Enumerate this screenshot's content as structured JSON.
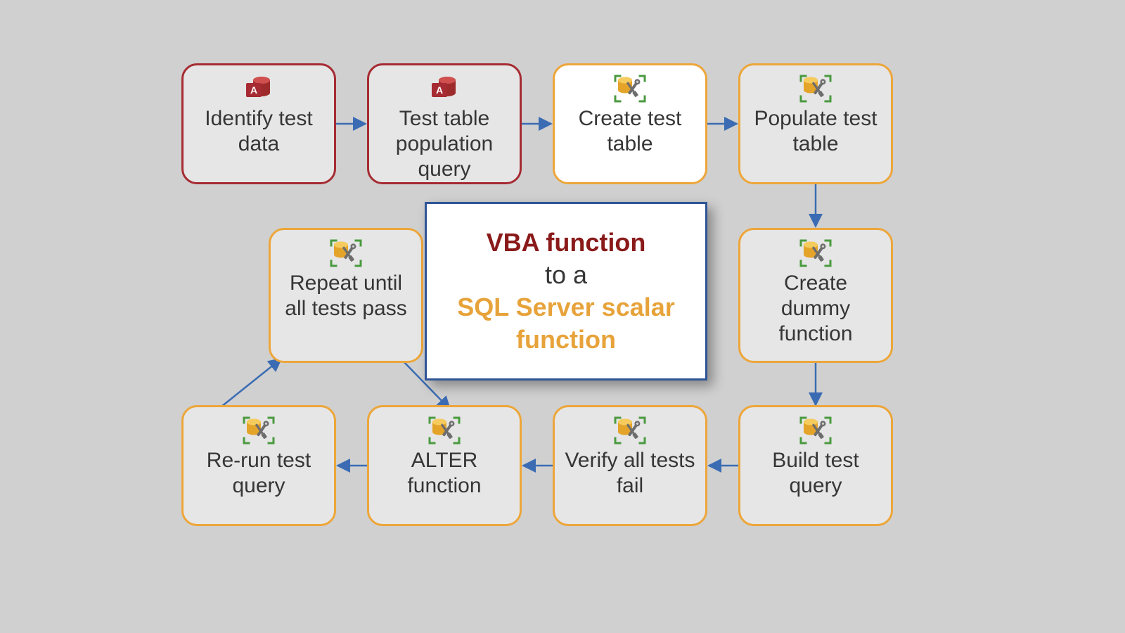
{
  "center": {
    "line1": "VBA function",
    "line2": "to a",
    "line3": "SQL Server scalar function"
  },
  "nodes": {
    "identify": {
      "label": "Identify test data",
      "icon": "access",
      "bg": "gray",
      "border": "maroon"
    },
    "popquery": {
      "label": "Test table population query",
      "icon": "access",
      "bg": "gray",
      "border": "maroon"
    },
    "createtable": {
      "label": "Create test table",
      "icon": "sql",
      "bg": "white",
      "border": "orange"
    },
    "populatetable": {
      "label": "Populate test table",
      "icon": "sql",
      "bg": "gray",
      "border": "orange"
    },
    "createdummy": {
      "label": "Create dummy function",
      "icon": "sql",
      "bg": "gray",
      "border": "orange"
    },
    "buildtest": {
      "label": "Build test query",
      "icon": "sql",
      "bg": "gray",
      "border": "orange"
    },
    "verifyfail": {
      "label": "Verify all tests fail",
      "icon": "sql",
      "bg": "gray",
      "border": "orange"
    },
    "alterfn": {
      "label": "ALTER function",
      "icon": "sql",
      "bg": "gray",
      "border": "orange"
    },
    "rerun": {
      "label": "Re-run test query",
      "icon": "sql",
      "bg": "gray",
      "border": "orange"
    },
    "repeat": {
      "label": "Repeat until all tests pass",
      "icon": "sql",
      "bg": "gray",
      "border": "orange"
    }
  },
  "colors": {
    "arrow": "#3b6cb3",
    "maroon": "#a62b32",
    "orange": "#eda63a"
  }
}
